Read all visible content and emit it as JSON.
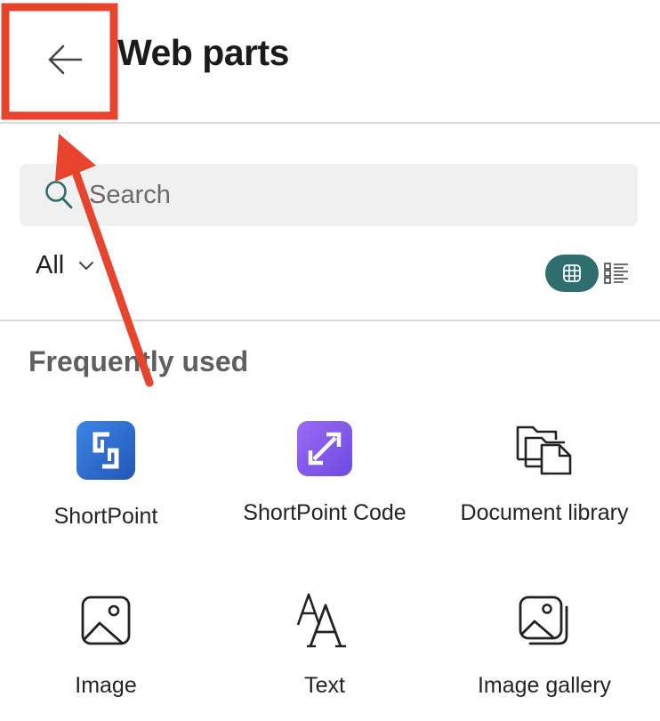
{
  "header": {
    "title": "Web parts"
  },
  "search": {
    "placeholder": "Search"
  },
  "filter": {
    "label": "All"
  },
  "section": {
    "title": "Frequently used"
  },
  "webparts": [
    {
      "label": "ShortPoint",
      "icon": "shortpoint-logo-icon"
    },
    {
      "label": "ShortPoint Code",
      "icon": "shortpoint-code-icon"
    },
    {
      "label": "Document library",
      "icon": "document-library-icon"
    },
    {
      "label": "Image",
      "icon": "image-icon"
    },
    {
      "label": "Text",
      "icon": "text-icon"
    },
    {
      "label": "Image gallery",
      "icon": "image-gallery-icon"
    }
  ],
  "colors": {
    "accent": "#2f6e6e",
    "annotation": "#e8432d",
    "shortpoint_blue": "#2f74d6",
    "shortpoint_code_purple": "#8a5cf0"
  }
}
